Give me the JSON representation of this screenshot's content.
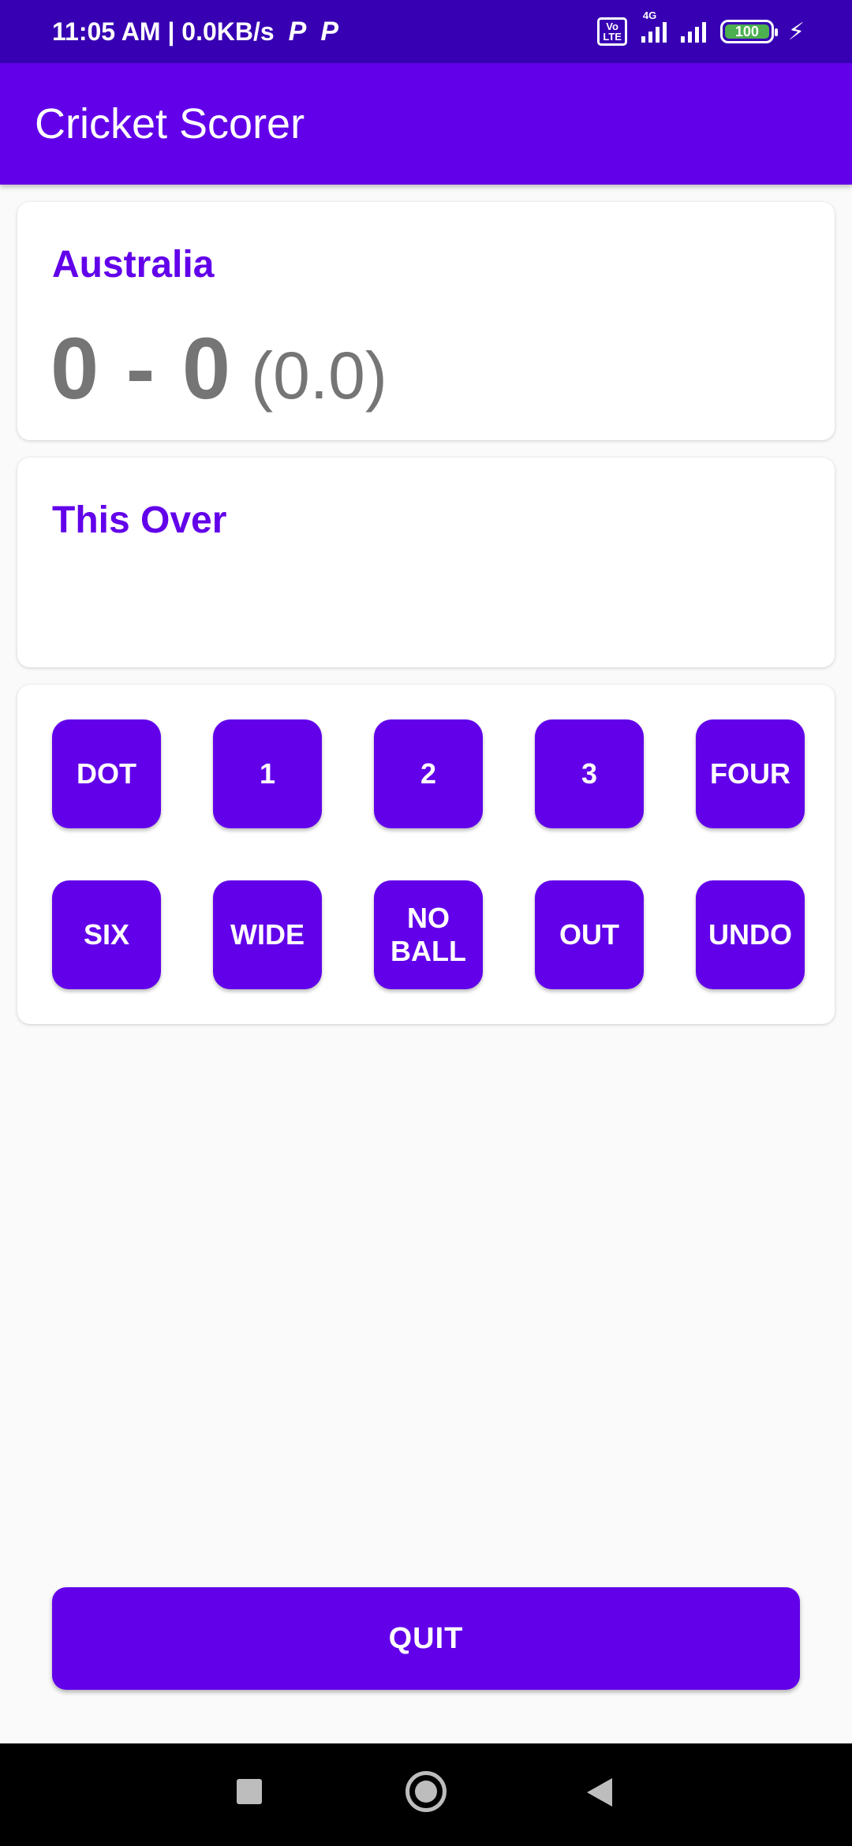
{
  "status_bar": {
    "time_speed": "11:05 AM | 0.0KB/s",
    "app_icons": [
      "P",
      "P"
    ],
    "volte": "Vo\nLTE",
    "network": "4G",
    "battery": "100"
  },
  "app_bar": {
    "title": "Cricket Scorer"
  },
  "score_card": {
    "team": "Australia",
    "score": "0 - 0",
    "overs": "(0.0)"
  },
  "over_card": {
    "title": "This Over"
  },
  "buttons": [
    {
      "label": "DOT"
    },
    {
      "label": "1"
    },
    {
      "label": "2"
    },
    {
      "label": "3"
    },
    {
      "label": "FOUR"
    },
    {
      "label": "SIX"
    },
    {
      "label": "WIDE"
    },
    {
      "label": "NO\nBALL"
    },
    {
      "label": "OUT"
    },
    {
      "label": "UNDO"
    }
  ],
  "quit": {
    "label": "QUIT"
  },
  "colors": {
    "primary": "#6200ea",
    "primary_dark": "#3700b3",
    "score_text": "#757575",
    "background": "#fafafa"
  },
  "icons": {
    "nav_recent": "square-icon",
    "nav_home": "circle-icon",
    "nav_back": "triangle-back-icon"
  }
}
